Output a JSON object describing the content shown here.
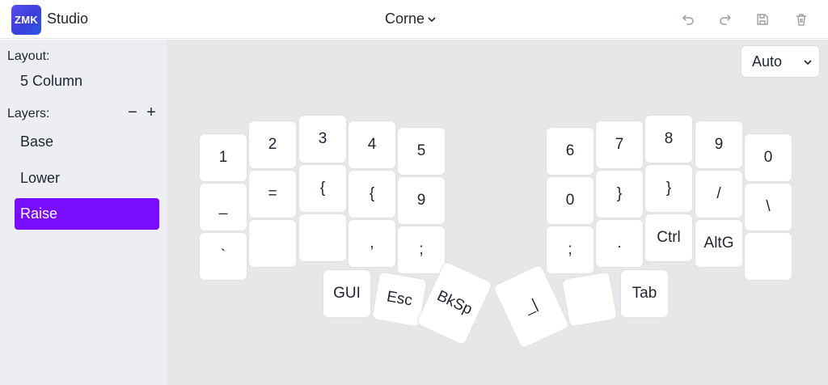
{
  "header": {
    "logo_text": "ZMK",
    "app_name": "Studio",
    "keyboard_name": "Corne"
  },
  "toolbar": {
    "undo_icon": "undo-icon",
    "redo_icon": "redo-icon",
    "save_icon": "save-icon",
    "delete_icon": "trash-icon"
  },
  "sidebar": {
    "layout_label": "Layout:",
    "layout_value": "5 Column",
    "layers_label": "Layers:",
    "remove_layer": "−",
    "add_layer": "+",
    "layers": [
      "Base",
      "Lower",
      "Raise"
    ],
    "active_layer": "Raise"
  },
  "main": {
    "zoom_value": "Auto"
  },
  "keys": {
    "l_r1": [
      "1",
      "2",
      "3",
      "4",
      "5"
    ],
    "l_r2": [
      "_",
      "=",
      "{",
      "{",
      "9"
    ],
    "l_r3": [
      "`",
      "",
      "",
      ",",
      ";"
    ],
    "l_thumb": [
      "GUI",
      "Esc",
      "BkSp"
    ],
    "r_r1": [
      "6",
      "7",
      "8",
      "9",
      "0"
    ],
    "r_r2": [
      "0",
      "}",
      "}",
      "/",
      "\\"
    ],
    "r_r3": [
      ";",
      ".",
      "Ctrl",
      "AltG",
      ""
    ],
    "r_thumb": [
      "_|",
      "",
      "Tab"
    ]
  },
  "colors": {
    "accent": "#7a0cff",
    "sidebar_bg": "#eceef1",
    "canvas_bg": "#e6e7e9"
  }
}
